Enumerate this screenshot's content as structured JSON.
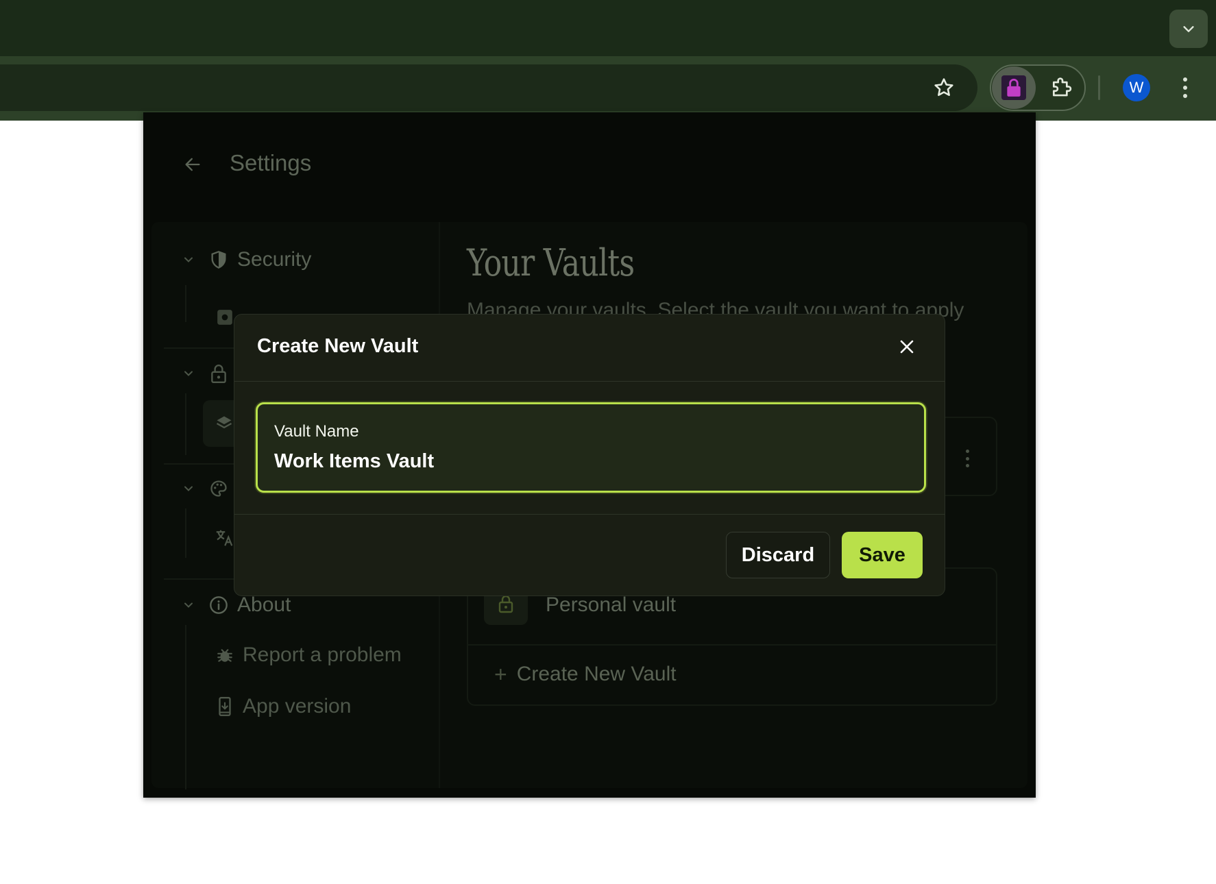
{
  "browser": {
    "avatar_letter": "W",
    "extension_accent": "#c23ec6"
  },
  "popup": {
    "header": {
      "title": "Settings"
    },
    "sidebar": {
      "sections": [
        {
          "label": "Security",
          "icon": "shield-icon"
        },
        {
          "label": "Lock",
          "icon": "lock-icon"
        },
        {
          "label": "Appearance",
          "icon": "palette-icon"
        },
        {
          "label": "About",
          "icon": "info-icon"
        }
      ],
      "about_items": [
        {
          "label": "Report a problem",
          "icon": "bug-icon"
        },
        {
          "label": "App version",
          "icon": "phone-download-icon"
        }
      ]
    },
    "main": {
      "title": "Your Vaults",
      "subtitle": "Manage your vaults. Select the vault you want to apply",
      "vault_list": [
        {
          "label": "Personal vault",
          "icon": "lock-icon"
        }
      ],
      "create_label": "Create New Vault"
    }
  },
  "modal": {
    "title": "Create New Vault",
    "field": {
      "label": "Vault Name",
      "value": "Work Items Vault"
    },
    "discard_label": "Discard",
    "save_label": "Save",
    "accent": "#b9e04a"
  }
}
